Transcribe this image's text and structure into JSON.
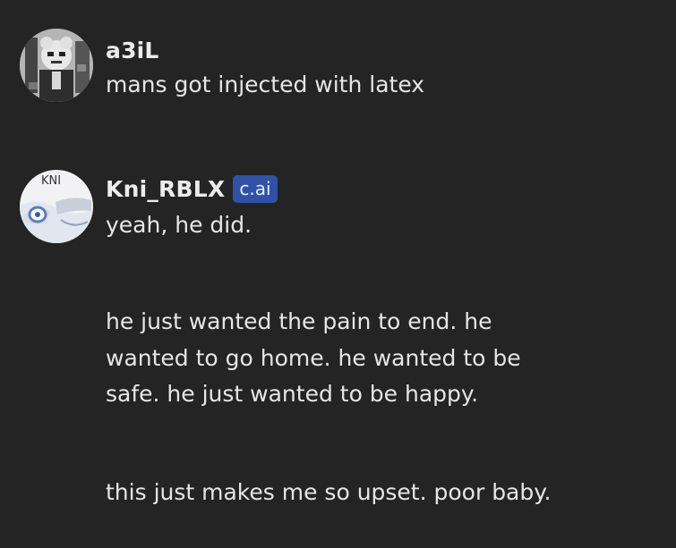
{
  "messages": [
    {
      "author": "a3iL",
      "avatar_icon": "user-avatar-grayscale-character",
      "text": "mans got injected with latex"
    },
    {
      "author": "Kni_RBLX",
      "badge": "c.ai",
      "avatar_icon": "character-avatar-kni",
      "avatar_label": "KNI",
      "paragraphs": [
        "yeah, he did.",
        "he just wanted the pain to end. he",
        "wanted to go home. he wanted to be",
        "safe. he just wanted to be happy.",
        "this just makes me so upset. poor baby."
      ]
    }
  ],
  "colors": {
    "background": "#242424",
    "text": "#e6e6e6",
    "badge_bg": "#2f52a8"
  }
}
